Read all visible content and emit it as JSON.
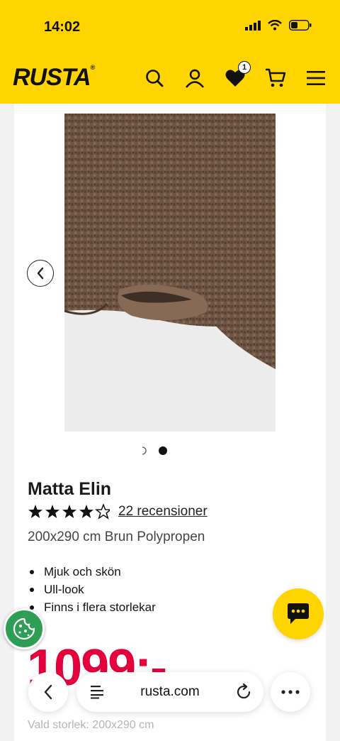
{
  "status_bar": {
    "time": "14:02"
  },
  "header": {
    "logo": "RUSTA",
    "logo_mark": "®",
    "favorites_count": "1",
    "icons": [
      "search-icon",
      "user-icon",
      "heart-icon",
      "cart-icon",
      "menu-icon"
    ]
  },
  "carousel": {
    "current_slide": 2,
    "total_slides": 2
  },
  "product": {
    "title": "Matta Elin",
    "rating": 4.5,
    "stars_text": "★★★★★",
    "reviews_label": "22 recensioner",
    "subtitle": "200x290 cm Brun Polypropen",
    "features": [
      "Mjuk och skön",
      "Ull-look",
      "Finns i flera storlekar"
    ],
    "price": "1099:-",
    "selected_size": "Vald storlek: 200x290 cm"
  },
  "browser": {
    "url": "rusta.com"
  },
  "colors": {
    "brand_yellow": "#ffd400",
    "price_red": "#e3003b",
    "cookie_green": "#2f9e55"
  }
}
